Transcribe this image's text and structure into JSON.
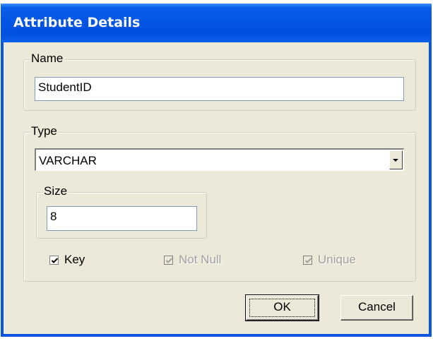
{
  "window": {
    "title": "Attribute Details"
  },
  "name_group": {
    "label": "Name",
    "value": "StudentID"
  },
  "type_group": {
    "label": "Type",
    "selected": "VARCHAR",
    "size_group": {
      "label": "Size",
      "value": "8"
    },
    "checkboxes": [
      {
        "label": "Key",
        "checked": true,
        "enabled": true
      },
      {
        "label": "Not Null",
        "checked": true,
        "enabled": false
      },
      {
        "label": "Unique",
        "checked": true,
        "enabled": false
      }
    ]
  },
  "buttons": {
    "ok": "OK",
    "cancel": "Cancel"
  },
  "colors": {
    "titlebar": "#0256e4",
    "dialog_bg": "#ece9d8",
    "disabled_text": "#a0a0a0"
  }
}
